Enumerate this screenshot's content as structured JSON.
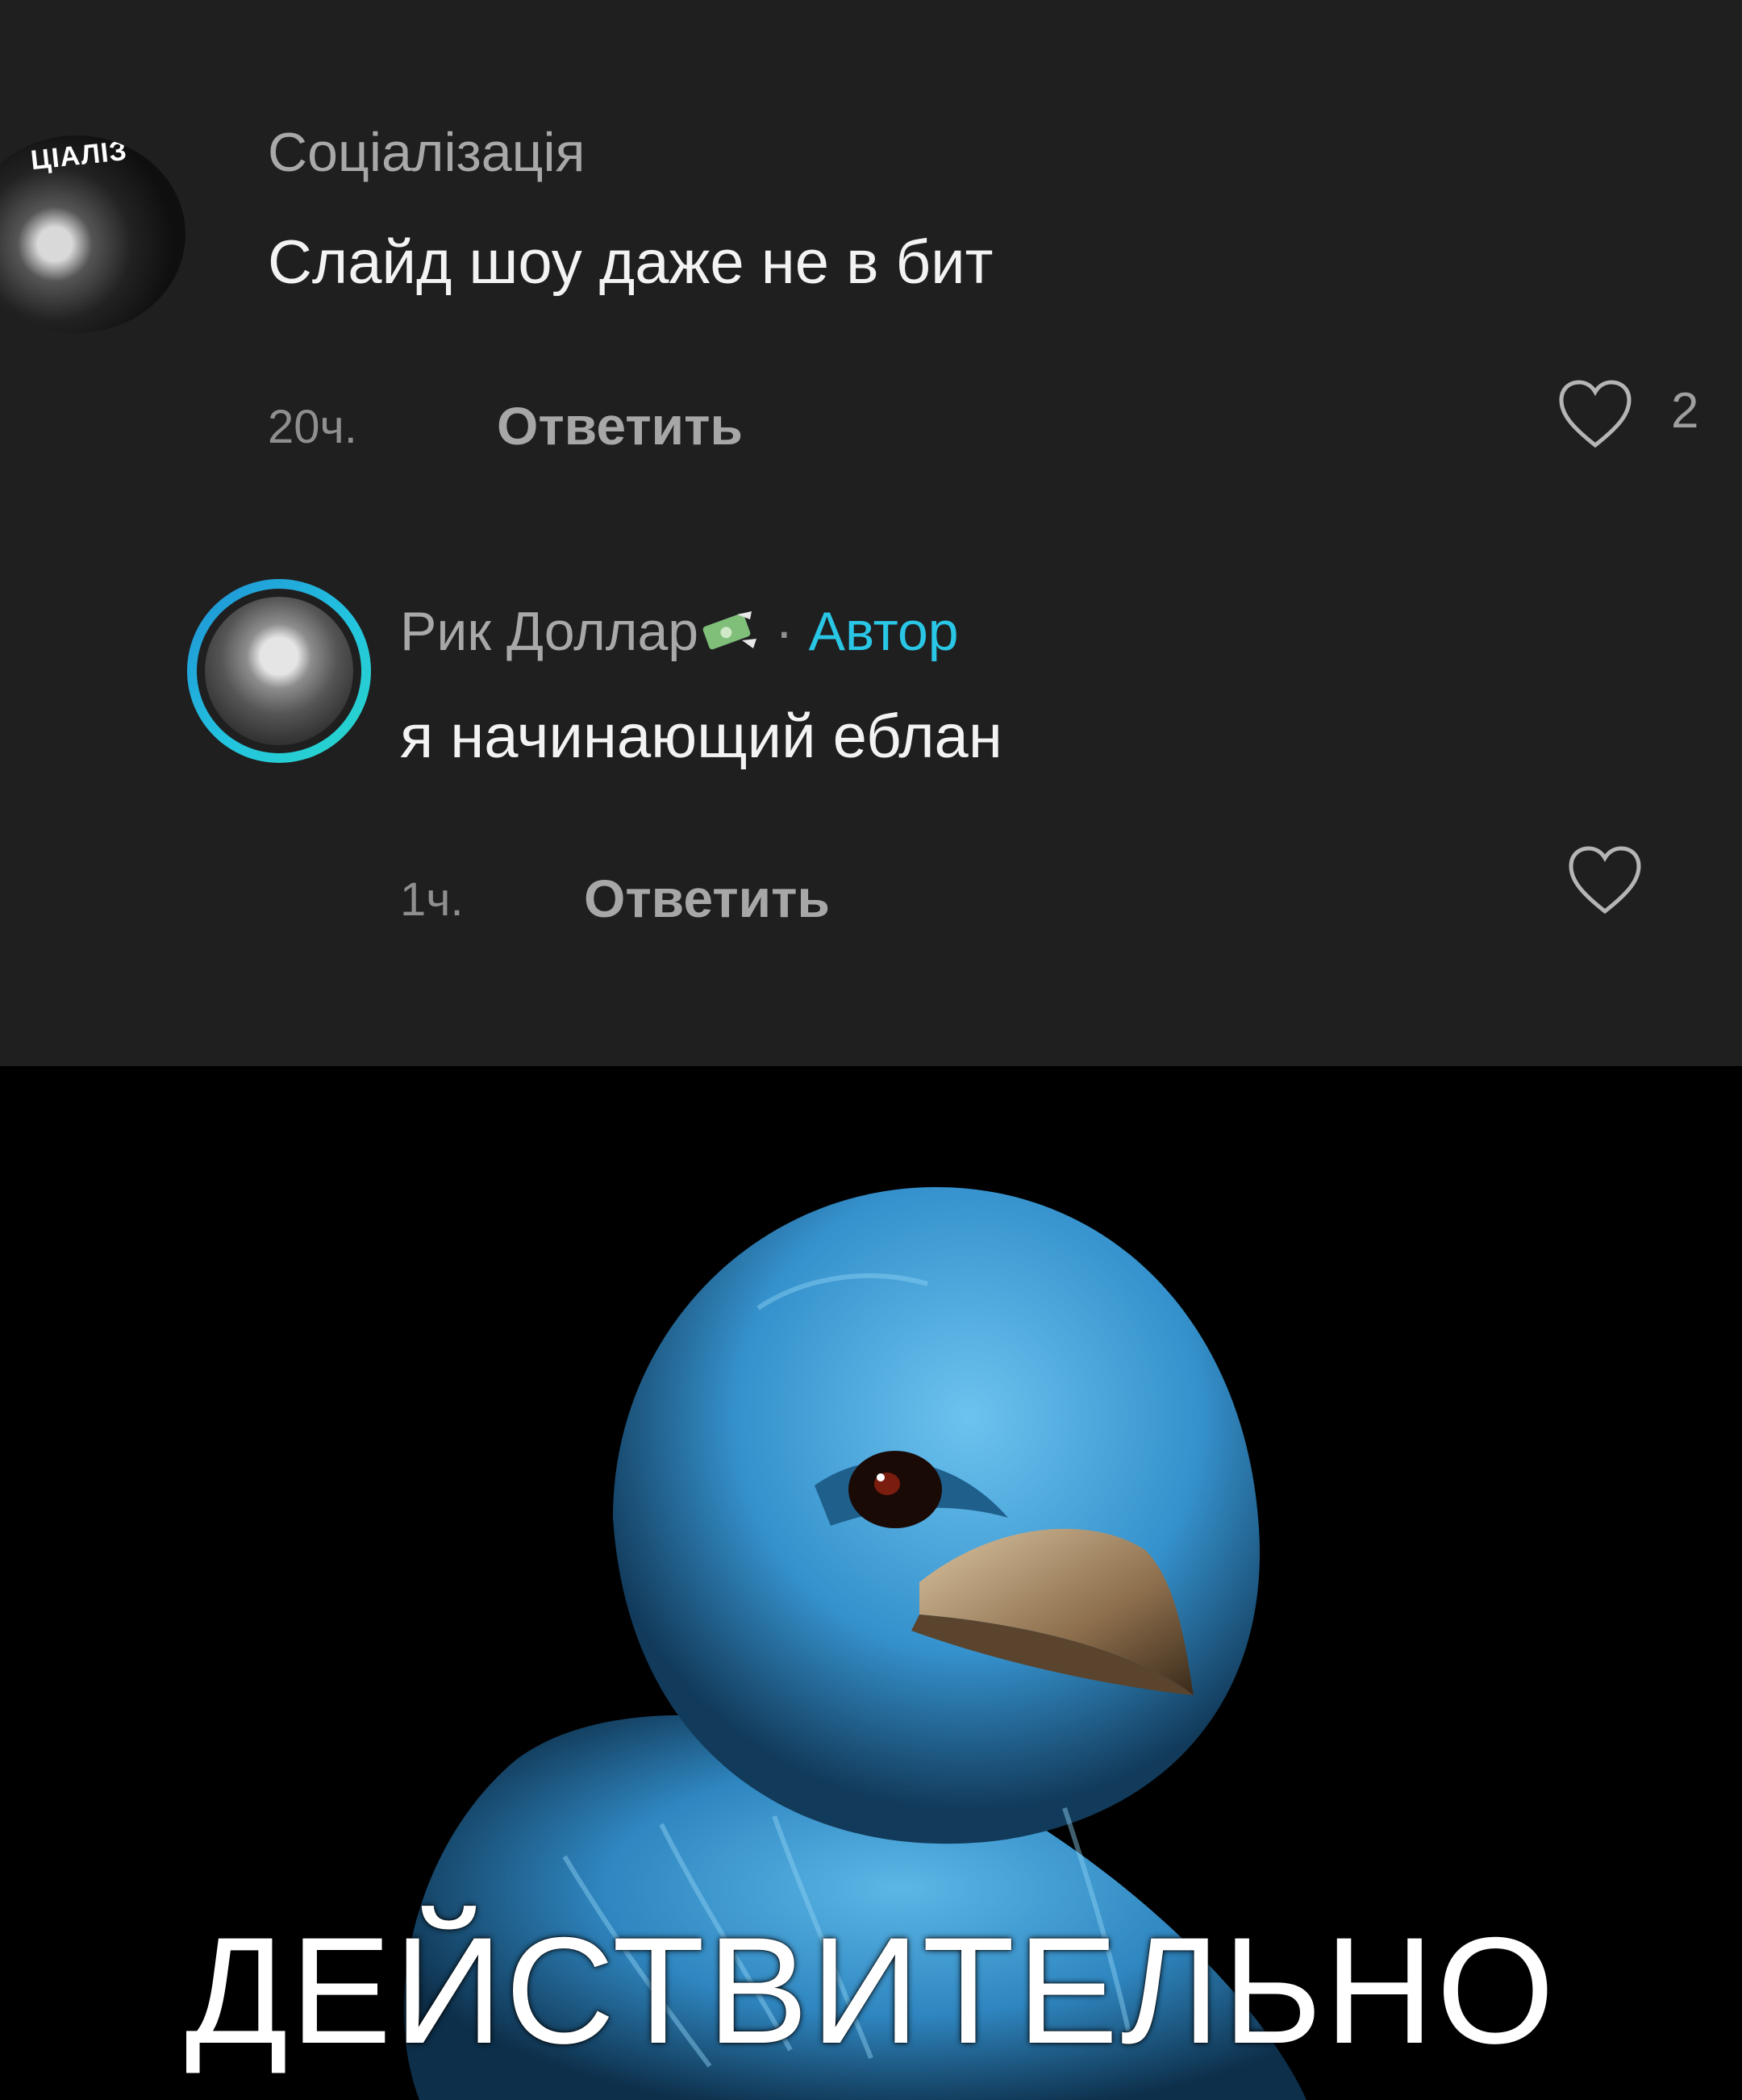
{
  "comments": [
    {
      "username": "Соціалізація",
      "avatar_text": "ЦІАЛІЗ",
      "text": "Слайд шоу даже не в бит",
      "time": "20ч.",
      "reply_label": "Ответить",
      "likes": "2"
    },
    {
      "username": "Рик Доллар",
      "separator": "·",
      "author_badge": "Автор",
      "text": "я начинающий еблан",
      "time": "1ч.",
      "reply_label": "Ответить"
    }
  ],
  "meme": {
    "caption": "ДЕЙСТВИТЕЛЬНО"
  },
  "colors": {
    "panel_bg": "#1f1f1f",
    "author_accent": "#29c6e6",
    "bird_blue": "#3f9fd4"
  }
}
